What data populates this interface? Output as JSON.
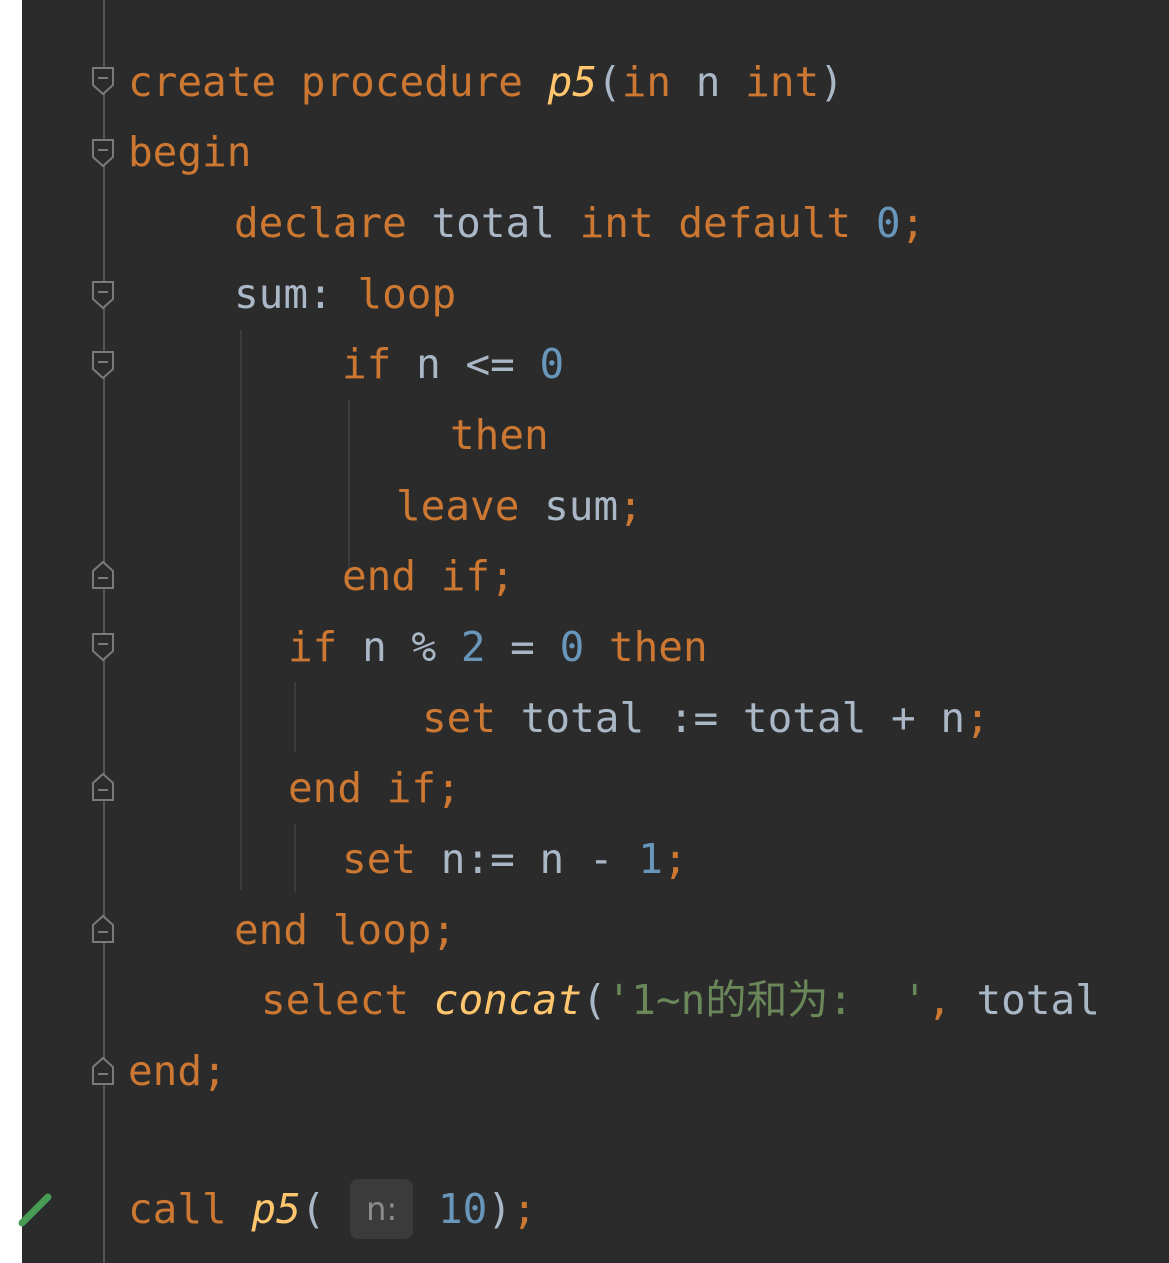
{
  "editor": {
    "lines": [
      [
        {
          "t": "create procedure ",
          "c": "kw"
        },
        {
          "t": "p5",
          "c": "fn"
        },
        {
          "t": "(",
          "c": "op"
        },
        {
          "t": "in ",
          "c": "kw"
        },
        {
          "t": "n ",
          "c": "id"
        },
        {
          "t": "int",
          "c": "kw"
        },
        {
          "t": ")",
          "c": "op"
        }
      ],
      [
        {
          "t": "begin",
          "c": "kw"
        }
      ],
      [
        {
          "t": "declare ",
          "c": "kw"
        },
        {
          "t": "total ",
          "c": "id"
        },
        {
          "t": "int default ",
          "c": "kw"
        },
        {
          "t": "0",
          "c": "num"
        },
        {
          "t": ";",
          "c": "kw"
        }
      ],
      [
        {
          "t": "sum",
          "c": "id"
        },
        {
          "t": ": ",
          "c": "op"
        },
        {
          "t": "loop",
          "c": "kw"
        }
      ],
      [
        {
          "t": "if ",
          "c": "kw"
        },
        {
          "t": "n ",
          "c": "id"
        },
        {
          "t": "<= ",
          "c": "op"
        },
        {
          "t": "0",
          "c": "num"
        }
      ],
      [
        {
          "t": "then",
          "c": "kw"
        }
      ],
      [
        {
          "t": "leave ",
          "c": "kw"
        },
        {
          "t": "sum",
          "c": "id"
        },
        {
          "t": ";",
          "c": "kw"
        }
      ],
      [
        {
          "t": "end if",
          "c": "kw"
        },
        {
          "t": ";",
          "c": "kw"
        }
      ],
      [
        {
          "t": "if ",
          "c": "kw"
        },
        {
          "t": "n ",
          "c": "id"
        },
        {
          "t": "% ",
          "c": "op"
        },
        {
          "t": "2",
          "c": "num"
        },
        {
          "t": " = ",
          "c": "op"
        },
        {
          "t": "0",
          "c": "num"
        },
        {
          "t": " then",
          "c": "kw"
        }
      ],
      [
        {
          "t": "set ",
          "c": "kw"
        },
        {
          "t": "total ",
          "c": "id"
        },
        {
          "t": ":= ",
          "c": "op"
        },
        {
          "t": "total ",
          "c": "id"
        },
        {
          "t": "+ ",
          "c": "op"
        },
        {
          "t": "n",
          "c": "id"
        },
        {
          "t": ";",
          "c": "kw"
        }
      ],
      [
        {
          "t": "end if",
          "c": "kw"
        },
        {
          "t": ";",
          "c": "kw"
        }
      ],
      [
        {
          "t": "set ",
          "c": "kw"
        },
        {
          "t": "n",
          "c": "id"
        },
        {
          "t": ":= ",
          "c": "op"
        },
        {
          "t": "n ",
          "c": "id"
        },
        {
          "t": "- ",
          "c": "op"
        },
        {
          "t": "1",
          "c": "num"
        },
        {
          "t": ";",
          "c": "kw"
        }
      ],
      [
        {
          "t": "end loop",
          "c": "kw"
        },
        {
          "t": ";",
          "c": "kw"
        }
      ],
      [
        {
          "t": "select ",
          "c": "kw"
        },
        {
          "t": "concat",
          "c": "fn"
        },
        {
          "t": "(",
          "c": "op"
        },
        {
          "t": "'1~n的和为:  '",
          "c": "str"
        },
        {
          "t": ", ",
          "c": "kw"
        },
        {
          "t": "total",
          "c": "id"
        }
      ],
      [
        {
          "t": "end",
          "c": "kw"
        },
        {
          "t": ";",
          "c": "kw"
        }
      ],
      [],
      [
        {
          "t": "call ",
          "c": "kw"
        },
        {
          "t": "p5",
          "c": "fn"
        },
        {
          "t": "( ",
          "c": "op"
        },
        {
          "t": "n:",
          "c": "hint"
        },
        {
          "t": " ",
          "c": "op"
        },
        {
          "t": "10",
          "c": "num"
        },
        {
          "t": ")",
          "c": "op"
        },
        {
          "t": ";",
          "c": "kw"
        }
      ]
    ]
  },
  "colors": {
    "background": "#2b2b2b",
    "keyword": "#cc7832",
    "identifier": "#a9b7c6",
    "number": "#6897bb",
    "string": "#6a8759",
    "function": "#ffc66d",
    "run_check": "#499c54"
  },
  "icons": {
    "fold_open": "fold-open-icon",
    "fold_close": "fold-close-icon",
    "run_check": "check-icon"
  }
}
